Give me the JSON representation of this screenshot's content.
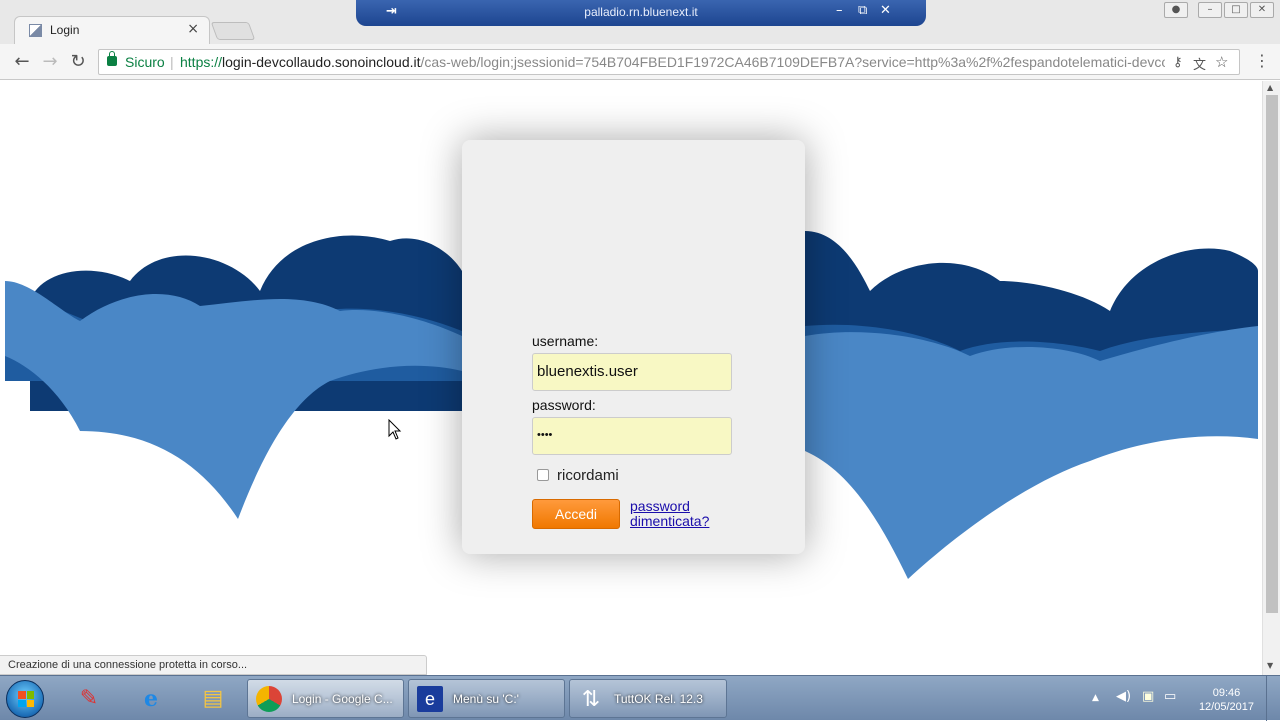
{
  "browser": {
    "tab_title": "Login",
    "tab_close": "×",
    "secure_label": "Sicuro",
    "url_scheme": "https://",
    "url_host": "login-devcollaudo.sonoincloud.it",
    "url_path": "/cas-web/login;jsessionid=754B704FBED1F1972CA46B7109DEFB7A?service=http%3a%2f%2fespandotelematici-devcollau",
    "back_icon": "←",
    "forward_icon": "→",
    "reload_icon": "↻",
    "menu_icon": "⋮",
    "star_icon": "☆"
  },
  "remote_desktop": {
    "title": "palladio.rn.bluenext.it",
    "pin": "⇥",
    "minimize": "–",
    "restore": "⧉",
    "close": "✕"
  },
  "login": {
    "username_label": "username:",
    "username_value": "bluenextis.user",
    "password_label": "password:",
    "password_value": "••••",
    "remember_label": "ricordami",
    "submit_label": "Accedi",
    "forgot_label": "password dimenticata?"
  },
  "status_bar": "Creazione di una connessione protetta in corso...",
  "taskbar": {
    "tasks": [
      {
        "label": "Login - Google C..."
      },
      {
        "label": "Menù su 'C:'"
      },
      {
        "label": "TuttOK  Rel. 12.3"
      }
    ],
    "time": "09:46",
    "date": "12/05/2017"
  },
  "colors": {
    "cloud_dark": "#0d3a73",
    "cloud_mid": "#1f5ca0",
    "cloud_light": "#4a87c6",
    "button_orange": "#f58220",
    "input_bg": "#f8f8c4"
  }
}
